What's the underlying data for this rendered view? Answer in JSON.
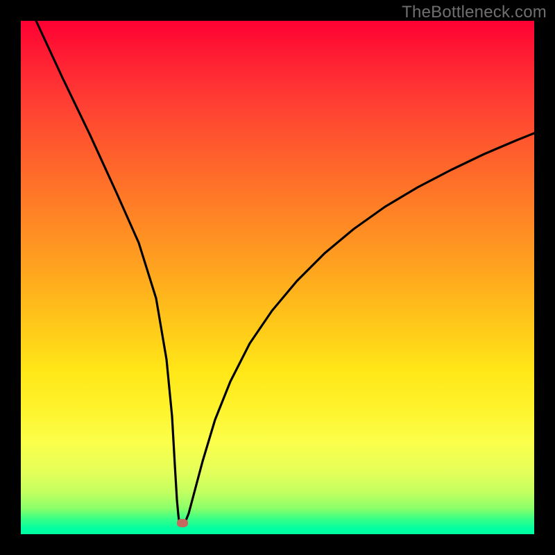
{
  "watermark": "TheBottleneck.com",
  "dot": {
    "x_pct": 31.5,
    "y_pct": 97.8
  },
  "chart_data": {
    "type": "line",
    "title": "",
    "xlabel": "",
    "ylabel": "",
    "xlim": [
      0,
      100
    ],
    "ylim": [
      0,
      100
    ],
    "series": [
      {
        "name": "left-branch",
        "x": [
          3,
          6,
          9,
          12,
          15,
          18,
          21,
          24,
          26,
          28,
          30
        ],
        "y": [
          100,
          89,
          78,
          67,
          56,
          45,
          34,
          23,
          15,
          8,
          2
        ]
      },
      {
        "name": "right-branch",
        "x": [
          32,
          34,
          36,
          38,
          41,
          44,
          48,
          52,
          56,
          61,
          66,
          72,
          78,
          84,
          90,
          96,
          100
        ],
        "y": [
          2,
          8,
          15,
          22,
          30,
          37,
          44,
          50,
          55,
          60,
          64,
          68,
          71,
          74,
          76,
          78,
          79
        ]
      }
    ],
    "marker": {
      "x": 31.5,
      "y": 2.2
    },
    "colors": {
      "curve": "#000000",
      "marker": "#c46a5e",
      "bg_top": "#ff0033",
      "bg_mid": "#ffe617",
      "bg_bottom": "#00ffa3"
    }
  }
}
